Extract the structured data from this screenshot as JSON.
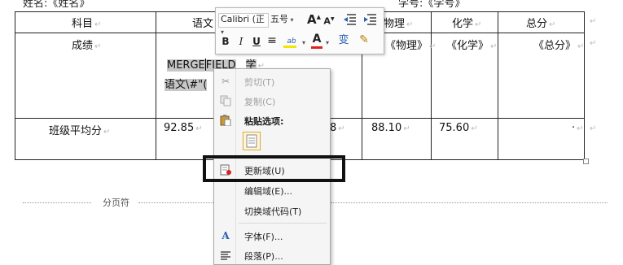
{
  "header": {
    "name_label": "姓名:《姓名》",
    "id_label": "学号:《学号》"
  },
  "table": {
    "headers": [
      "科目",
      "语文",
      "物理",
      "化学",
      "总分"
    ],
    "score_row_label": "成绩",
    "score_fields": [
      "《物理》",
      "《化学》",
      "《总分》"
    ],
    "avg_row_label": "班级平均分",
    "avg_values": [
      "92.85",
      "8",
      "88.10",
      "75.60",
      "·"
    ]
  },
  "field_code": {
    "line1_a": "MERGE",
    "line1_b": "FIELD",
    "line1_c": "学",
    "line2": "语文\\#\"("
  },
  "mini_toolbar": {
    "font_name": "Calibri (正",
    "font_size": "五号",
    "grow_font": "A",
    "shrink_font": "A",
    "bold": "B",
    "italic": "I",
    "underline": "U",
    "center": "≡",
    "highlight": "ab",
    "font_color": "A",
    "phonetic": "变",
    "format_painter": "✎"
  },
  "context_menu": {
    "items": [
      {
        "label": "剪切(T)",
        "icon": "scissors-icon",
        "enabled": false
      },
      {
        "label": "复制(C)",
        "icon": "copy-icon",
        "enabled": false
      },
      {
        "label": "粘贴选项:",
        "icon": "paste-icon",
        "enabled": true
      },
      {
        "label": "更新域(U)",
        "icon": "update-field-icon",
        "enabled": true
      },
      {
        "label": "编辑域(E)...",
        "icon": "",
        "enabled": true
      },
      {
        "label": "切换域代码(T)",
        "icon": "",
        "enabled": true
      },
      {
        "label": "字体(F)...",
        "icon": "font-icon",
        "enabled": true
      },
      {
        "label": "段落(P)...",
        "icon": "paragraph-icon",
        "enabled": true
      }
    ]
  },
  "page_break_label": "分页符",
  "colors": {
    "highlight_fill": "#c7c7c7",
    "font_color_red": "#e02020",
    "highlighter_yellow": "#f2e600",
    "accent_blue": "#2b5fb3"
  }
}
